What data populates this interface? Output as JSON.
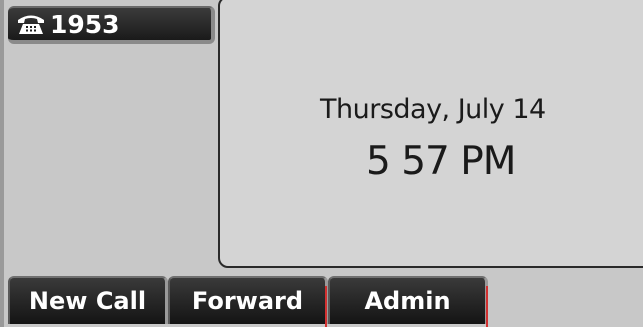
{
  "line_key": {
    "icon": "phone-handset-icon",
    "extension": "1953"
  },
  "status": {
    "date": "Thursday, July 14",
    "time": "5 57 PM"
  },
  "softkeys": [
    {
      "label": "New Call"
    },
    {
      "label": "Forward"
    },
    {
      "label": "Admin"
    }
  ],
  "colors": {
    "key_background": "#1e1e1e",
    "screen_background": "#c8c8c8",
    "panel_background": "#d4d4d4",
    "accent_marker": "#d23030"
  }
}
